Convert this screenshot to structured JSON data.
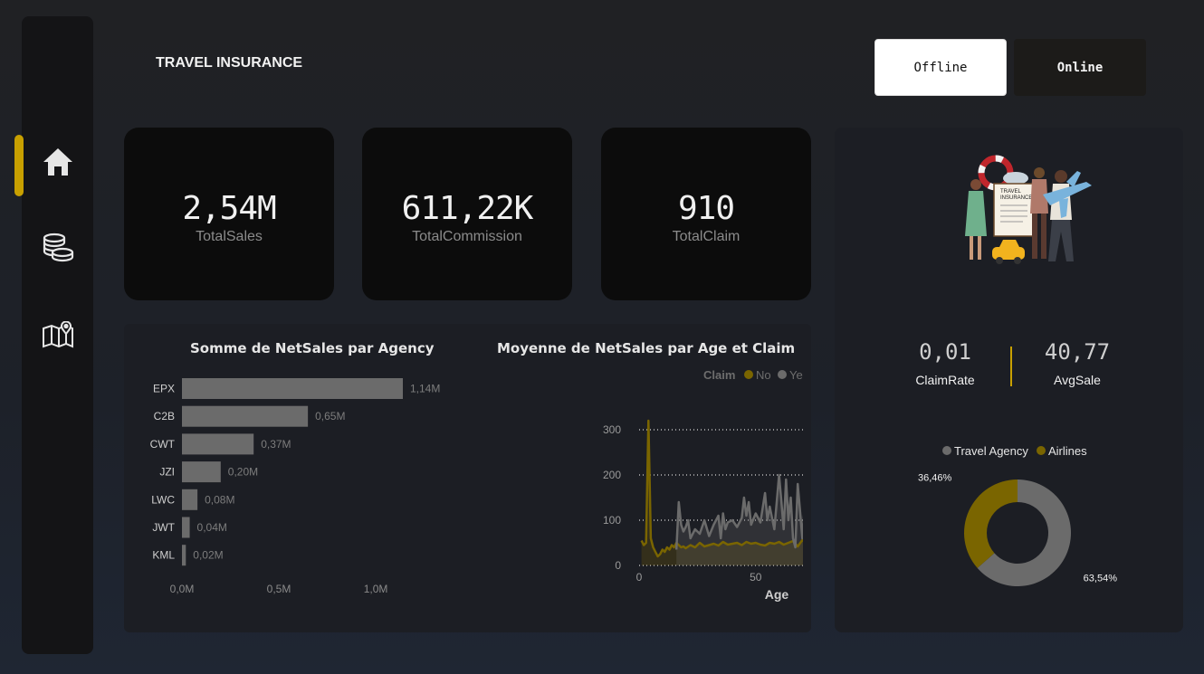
{
  "app": {
    "title": "TRAVEL INSURANCE"
  },
  "nav": {
    "items": [
      {
        "icon": "home-icon"
      },
      {
        "icon": "coins-icon"
      },
      {
        "icon": "map-icon"
      }
    ]
  },
  "toggle": {
    "offline": "Offline",
    "online": "Online",
    "selected": "Offline"
  },
  "kpis": [
    {
      "value": "2,54M",
      "label": "TotalSales"
    },
    {
      "value": "611,22K",
      "label": "TotalCommission"
    },
    {
      "value": "910",
      "label": "TotalClaim"
    }
  ],
  "stats": {
    "claim_rate": {
      "value": "0,01",
      "label": "ClaimRate"
    },
    "avg_sale": {
      "value": "40,77",
      "label": "AvgSale"
    }
  },
  "colors": {
    "accent": "#c8a000",
    "gold_series": "#7a6500",
    "gray_series": "#6b6b6b"
  },
  "chart_data": [
    {
      "type": "bar",
      "orientation": "horizontal",
      "title": "Somme de NetSales par Agency",
      "categories": [
        "EPX",
        "C2B",
        "CWT",
        "JZI",
        "LWC",
        "JWT",
        "KML"
      ],
      "values": [
        1.14,
        0.65,
        0.37,
        0.2,
        0.08,
        0.04,
        0.02
      ],
      "data_labels": [
        "1,14M",
        "0,65M",
        "0,37M",
        "0,20M",
        "0,08M",
        "0,04M",
        "0,02M"
      ],
      "unit": "M",
      "xlim": [
        0,
        1.14
      ],
      "xticks": [
        0,
        0.5,
        1.0
      ],
      "xtick_labels": [
        "0,0M",
        "0,5M",
        "1,0M"
      ],
      "color": "#6b6b6b"
    },
    {
      "type": "line",
      "title": "Moyenne de NetSales par Age et Claim",
      "xlabel": "Age",
      "ylabel": "",
      "xlim": [
        0,
        118
      ],
      "ylim": [
        0,
        320
      ],
      "xticks": [
        0,
        50,
        100
      ],
      "yticks": [
        0,
        100,
        200,
        300
      ],
      "legend": {
        "title": "Claim",
        "position": "top"
      },
      "series": [
        {
          "name": "No",
          "color": "#7a6500",
          "points": [
            [
              1,
              55
            ],
            [
              2,
              45
            ],
            [
              3,
              50
            ],
            [
              4,
              320
            ],
            [
              5,
              60
            ],
            [
              6,
              40
            ],
            [
              7,
              30
            ],
            [
              8,
              20
            ],
            [
              9,
              25
            ],
            [
              10,
              35
            ],
            [
              11,
              30
            ],
            [
              12,
              40
            ],
            [
              13,
              35
            ],
            [
              14,
              45
            ],
            [
              15,
              40
            ],
            [
              16,
              50
            ],
            [
              17,
              45
            ],
            [
              18,
              40
            ],
            [
              19,
              42
            ],
            [
              20,
              38
            ],
            [
              22,
              45
            ],
            [
              24,
              40
            ],
            [
              26,
              50
            ],
            [
              28,
              42
            ],
            [
              30,
              45
            ],
            [
              32,
              48
            ],
            [
              34,
              44
            ],
            [
              36,
              52
            ],
            [
              38,
              46
            ],
            [
              40,
              48
            ],
            [
              42,
              50
            ],
            [
              44,
              45
            ],
            [
              46,
              52
            ],
            [
              48,
              48
            ],
            [
              50,
              50
            ],
            [
              52,
              46
            ],
            [
              54,
              44
            ],
            [
              56,
              50
            ],
            [
              58,
              48
            ],
            [
              60,
              52
            ],
            [
              62,
              46
            ],
            [
              64,
              50
            ],
            [
              66,
              54
            ],
            [
              68,
              42
            ],
            [
              70,
              56
            ],
            [
              72,
              50
            ],
            [
              74,
              48
            ],
            [
              76,
              58
            ],
            [
              78,
              52
            ],
            [
              80,
              50
            ],
            [
              81,
              30
            ],
            [
              82,
              60
            ],
            [
              84,
              100
            ],
            [
              86,
              90
            ],
            [
              90,
              85
            ],
            [
              95,
              80
            ],
            [
              100,
              75
            ],
            [
              105,
              70
            ],
            [
              110,
              62
            ],
            [
              115,
              55
            ],
            [
              118,
              50
            ]
          ]
        },
        {
          "name": "Yes",
          "color": "#6b6b6b",
          "points": [
            [
              16,
              35
            ],
            [
              17,
              140
            ],
            [
              18,
              90
            ],
            [
              19,
              75
            ],
            [
              20,
              85
            ],
            [
              21,
              100
            ],
            [
              22,
              60
            ],
            [
              24,
              80
            ],
            [
              26,
              70
            ],
            [
              28,
              100
            ],
            [
              30,
              65
            ],
            [
              32,
              90
            ],
            [
              34,
              110
            ],
            [
              35,
              60
            ],
            [
              36,
              115
            ],
            [
              37,
              80
            ],
            [
              38,
              95
            ],
            [
              40,
              100
            ],
            [
              42,
              85
            ],
            [
              44,
              105
            ],
            [
              45,
              150
            ],
            [
              46,
              110
            ],
            [
              47,
              140
            ],
            [
              48,
              90
            ],
            [
              50,
              115
            ],
            [
              52,
              95
            ],
            [
              54,
              160
            ],
            [
              55,
              100
            ],
            [
              56,
              130
            ],
            [
              58,
              80
            ],
            [
              60,
              200
            ],
            [
              61,
              140
            ],
            [
              62,
              80
            ],
            [
              63,
              190
            ],
            [
              64,
              100
            ],
            [
              65,
              150
            ],
            [
              66,
              60
            ],
            [
              67,
              40
            ],
            [
              68,
              180
            ],
            [
              69,
              120
            ],
            [
              70,
              60
            ],
            [
              71,
              130
            ],
            [
              72,
              40
            ],
            [
              73,
              200
            ],
            [
              74,
              160
            ],
            [
              75,
              100
            ],
            [
              76,
              140
            ],
            [
              77,
              60
            ],
            [
              78,
              140
            ],
            [
              79,
              180
            ],
            [
              80,
              200
            ],
            [
              81,
              100
            ],
            [
              82,
              250
            ],
            [
              83,
              220
            ],
            [
              84,
              80
            ],
            [
              86,
              75
            ],
            [
              90,
              75
            ],
            [
              95,
              75
            ],
            [
              100,
              75
            ],
            [
              105,
              75
            ],
            [
              110,
              75
            ],
            [
              118,
              75
            ]
          ]
        }
      ]
    },
    {
      "type": "pie",
      "donut": true,
      "legend": {
        "position": "top"
      },
      "slices": [
        {
          "name": "Travel Agency",
          "value": 63.54,
          "label": "63,54%",
          "color": "#6b6b6b"
        },
        {
          "name": "Airlines",
          "value": 36.46,
          "label": "36,46%",
          "color": "#7a6500"
        }
      ]
    }
  ]
}
